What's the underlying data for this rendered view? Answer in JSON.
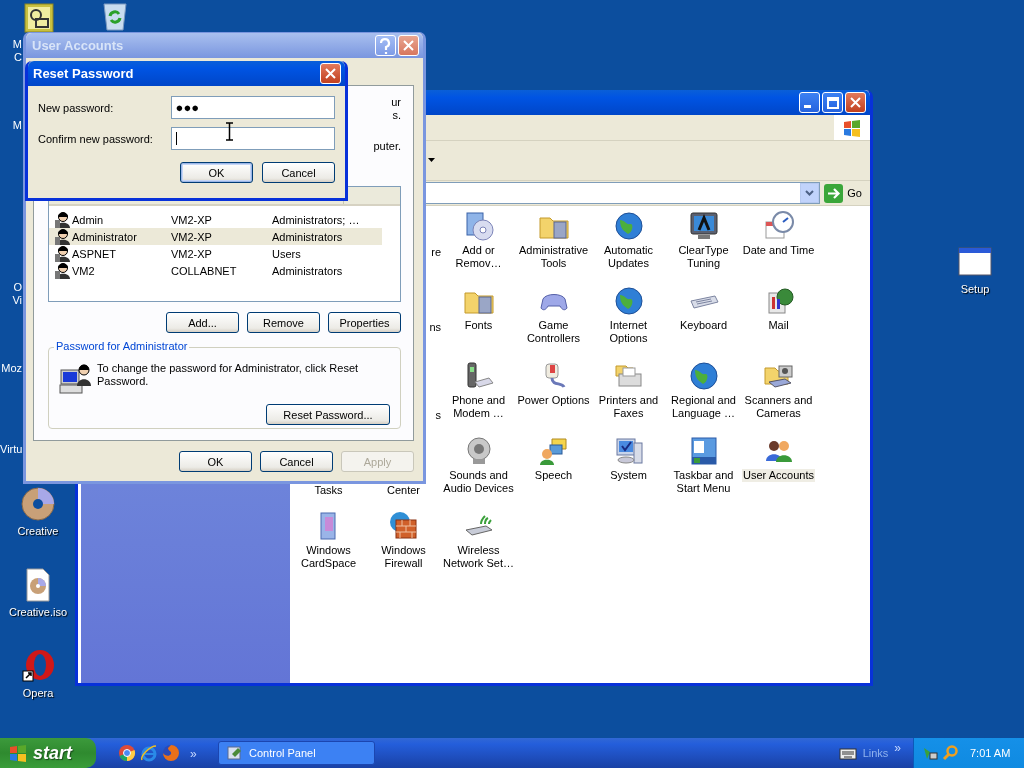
{
  "desktop": {
    "cut_labels": [
      "M",
      "C",
      "M",
      "O",
      "Vi",
      "Moz",
      "Virtu"
    ],
    "icons": [
      {
        "label": "Creative"
      },
      {
        "label": "Creative.iso"
      },
      {
        "label": "Opera"
      },
      {
        "label": "Setup"
      }
    ]
  },
  "control_panel": {
    "address_button": "Go",
    "rows": [
      {
        "items": [
          {
            "kind": "partial",
            "label": "re"
          },
          {
            "kind": "item",
            "label": "Add or\nRemov…",
            "selected": false
          },
          {
            "kind": "item",
            "label": "Administrative\nTools",
            "selected": false
          },
          {
            "kind": "item",
            "label": "Automatic\nUpdates",
            "selected": false
          },
          {
            "kind": "item",
            "label": "ClearType\nTuning",
            "selected": false
          },
          {
            "kind": "item",
            "label": "Date and Time",
            "selected": false
          }
        ]
      },
      {
        "items": [
          {
            "kind": "partial",
            "label": "ns"
          },
          {
            "kind": "item",
            "label": "Fonts",
            "selected": false
          },
          {
            "kind": "item",
            "label": "Game\nControllers",
            "selected": false
          },
          {
            "kind": "item",
            "label": "Internet\nOptions",
            "selected": false
          },
          {
            "kind": "item",
            "label": "Keyboard",
            "selected": false
          },
          {
            "kind": "item",
            "label": "Mail",
            "selected": false
          }
        ]
      },
      {
        "items": [
          {
            "kind": "partial",
            "label": "s"
          },
          {
            "kind": "item",
            "label": "Phone and\nModem …",
            "selected": false
          },
          {
            "kind": "item",
            "label": "Power Options",
            "selected": false
          },
          {
            "kind": "item",
            "label": "Printers and\nFaxes",
            "selected": false
          },
          {
            "kind": "item",
            "label": "Regional and\nLanguage …",
            "selected": false
          },
          {
            "kind": "item",
            "label": "Scanners and\nCameras",
            "selected": false
          }
        ]
      },
      {
        "items": [
          {
            "kind": "partial",
            "label": "Tasks"
          },
          {
            "kind": "partial",
            "label": "Center"
          },
          {
            "kind": "item",
            "label": "Sounds and\nAudio Devices",
            "selected": false
          },
          {
            "kind": "item",
            "label": "Speech",
            "selected": false
          },
          {
            "kind": "item",
            "label": "System",
            "selected": false
          },
          {
            "kind": "item",
            "label": "Taskbar and\nStart Menu",
            "selected": false
          },
          {
            "kind": "item",
            "label": "User Accounts",
            "selected": true
          }
        ]
      },
      {
        "items": [
          {
            "kind": "item",
            "label": "Windows\nCardSpace",
            "selected": false
          },
          {
            "kind": "item",
            "label": "Windows\nFirewall",
            "selected": false
          },
          {
            "kind": "item",
            "label": "Wireless\nNetwork Set…",
            "selected": false
          }
        ]
      }
    ]
  },
  "user_accounts": {
    "title": "User Accounts",
    "active": false,
    "cut_text": [
      "ur",
      "s.",
      "puter."
    ],
    "users": [
      {
        "name": "Admin",
        "domain": "VM2-XP",
        "group": "Administrators; …",
        "selected": false
      },
      {
        "name": "Administrator",
        "domain": "VM2-XP",
        "group": "Administrators",
        "selected": true
      },
      {
        "name": "ASPNET",
        "domain": "VM2-XP",
        "group": "Users",
        "selected": false
      },
      {
        "name": "VM2",
        "domain": "COLLABNET",
        "group": "Administrators",
        "selected": false
      }
    ],
    "list_buttons": [
      "Add...",
      "Remove",
      "Properties"
    ],
    "group_title": "Password for Administrator",
    "group_text": "To change the password for Administrator, click Reset Password.",
    "reset_button": "Reset Password...",
    "footer_buttons": [
      {
        "label": "OK",
        "disabled": false
      },
      {
        "label": "Cancel",
        "disabled": false
      },
      {
        "label": "Apply",
        "disabled": true
      }
    ]
  },
  "reset_password": {
    "title": "Reset Password",
    "active": true,
    "fields": [
      {
        "label": "New password:",
        "value": "●●●",
        "focused": false
      },
      {
        "label": "Confirm new password:",
        "focused": true
      }
    ],
    "buttons": [
      {
        "label": "OK",
        "default": true
      },
      {
        "label": "Cancel",
        "default": false
      }
    ]
  },
  "taskbar": {
    "start": "start",
    "quick_launch_more": "»",
    "tasks": [
      {
        "label": "Control Panel",
        "selected": false
      }
    ],
    "links": "Links",
    "links_more": "»",
    "clock": "7:01 AM"
  }
}
